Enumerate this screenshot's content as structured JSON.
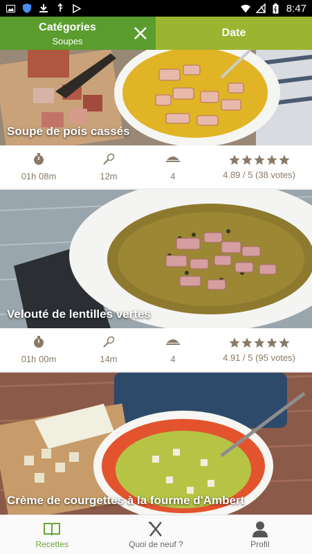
{
  "status_bar": {
    "time": "8:47"
  },
  "tabs": {
    "categories_title": "Catégories",
    "categories_subtitle": "Soupes",
    "date_label": "Date"
  },
  "recipes": [
    {
      "title": "Soupe de pois cassés",
      "time": "01h 08m",
      "prep": "12m",
      "servings": "4",
      "rating": "4.89 / 5 (38 votes)",
      "stars": 5
    },
    {
      "title": "Velouté de lentilles vertes",
      "time": "01h 00m",
      "prep": "14m",
      "servings": "4",
      "rating": "4.91 / 5 (95 votes)",
      "stars": 5
    },
    {
      "title": "Crème de courgettes à la fourme d'Ambert"
    }
  ],
  "bottom_nav": {
    "recettes": "Recettes",
    "quoi_de_neuf": "Quoi de neuf ?",
    "profil": "Profil"
  },
  "colors": {
    "tab_active": "#5a9d2e",
    "tab_date": "#9cb531",
    "stat_text": "#8a7a66",
    "nav_active": "#6aa33a"
  }
}
